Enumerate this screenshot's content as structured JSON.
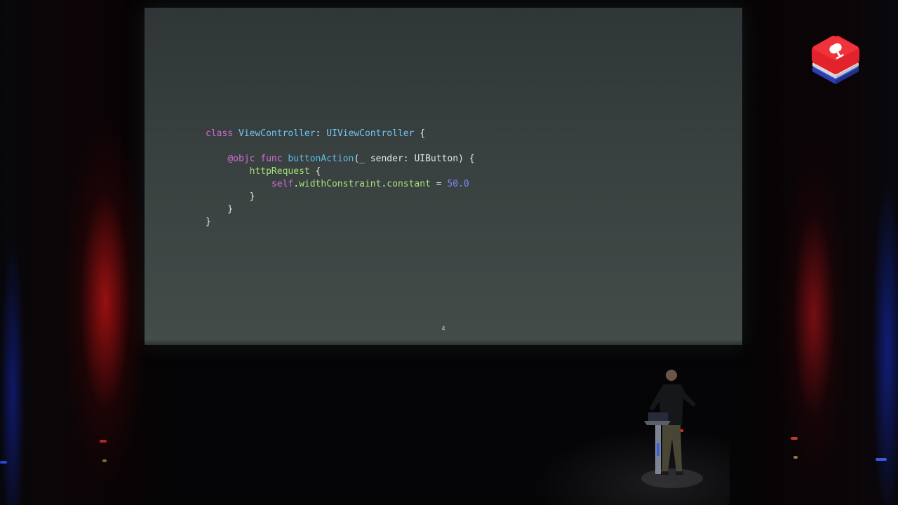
{
  "slide": {
    "code_lines": [
      [
        {
          "text": "class",
          "role": "keyword"
        },
        {
          "text": " ",
          "role": "plain"
        },
        {
          "text": "ViewController",
          "role": "type"
        },
        {
          "text": ": ",
          "role": "plain"
        },
        {
          "text": "UIViewController",
          "role": "type"
        },
        {
          "text": " {",
          "role": "plain"
        }
      ],
      [],
      [
        {
          "text": "    ",
          "role": "plain"
        },
        {
          "text": "@objc",
          "role": "keyword"
        },
        {
          "text": " ",
          "role": "plain"
        },
        {
          "text": "func",
          "role": "keyword"
        },
        {
          "text": " ",
          "role": "plain"
        },
        {
          "text": "buttonAction",
          "role": "function"
        },
        {
          "text": "(_ sender: ",
          "role": "plain"
        },
        {
          "text": "UIButton",
          "role": "plain"
        },
        {
          "text": ") {",
          "role": "plain"
        }
      ],
      [
        {
          "text": "        ",
          "role": "plain"
        },
        {
          "text": "httpRequest",
          "role": "call"
        },
        {
          "text": " {",
          "role": "plain"
        }
      ],
      [
        {
          "text": "            ",
          "role": "plain"
        },
        {
          "text": "self",
          "role": "keyword"
        },
        {
          "text": ".",
          "role": "plain"
        },
        {
          "text": "widthConstraint",
          "role": "call"
        },
        {
          "text": ".",
          "role": "plain"
        },
        {
          "text": "constant",
          "role": "call"
        },
        {
          "text": " = ",
          "role": "plain"
        },
        {
          "text": "50.0",
          "role": "number"
        }
      ],
      [
        {
          "text": "        }",
          "role": "plain"
        }
      ],
      [
        {
          "text": "    }",
          "role": "plain"
        }
      ],
      [
        {
          "text": "}",
          "role": "plain"
        }
      ]
    ],
    "page_number": "4"
  },
  "colors": {
    "keyword": "#d36bd6",
    "type": "#6fc5f2",
    "function": "#5dbbe6",
    "call": "#a7e07a",
    "number": "#7e89f2",
    "plain": "#e6e6e6",
    "slide_background": "#3b4342",
    "curtain_red": "#c81414",
    "stage_light_blue": "#1428b4",
    "logo_red": "#e0202a"
  },
  "icons": {
    "conference_logo": "stacked-microphone-logo-icon",
    "speaker": "presenter-at-podium"
  }
}
